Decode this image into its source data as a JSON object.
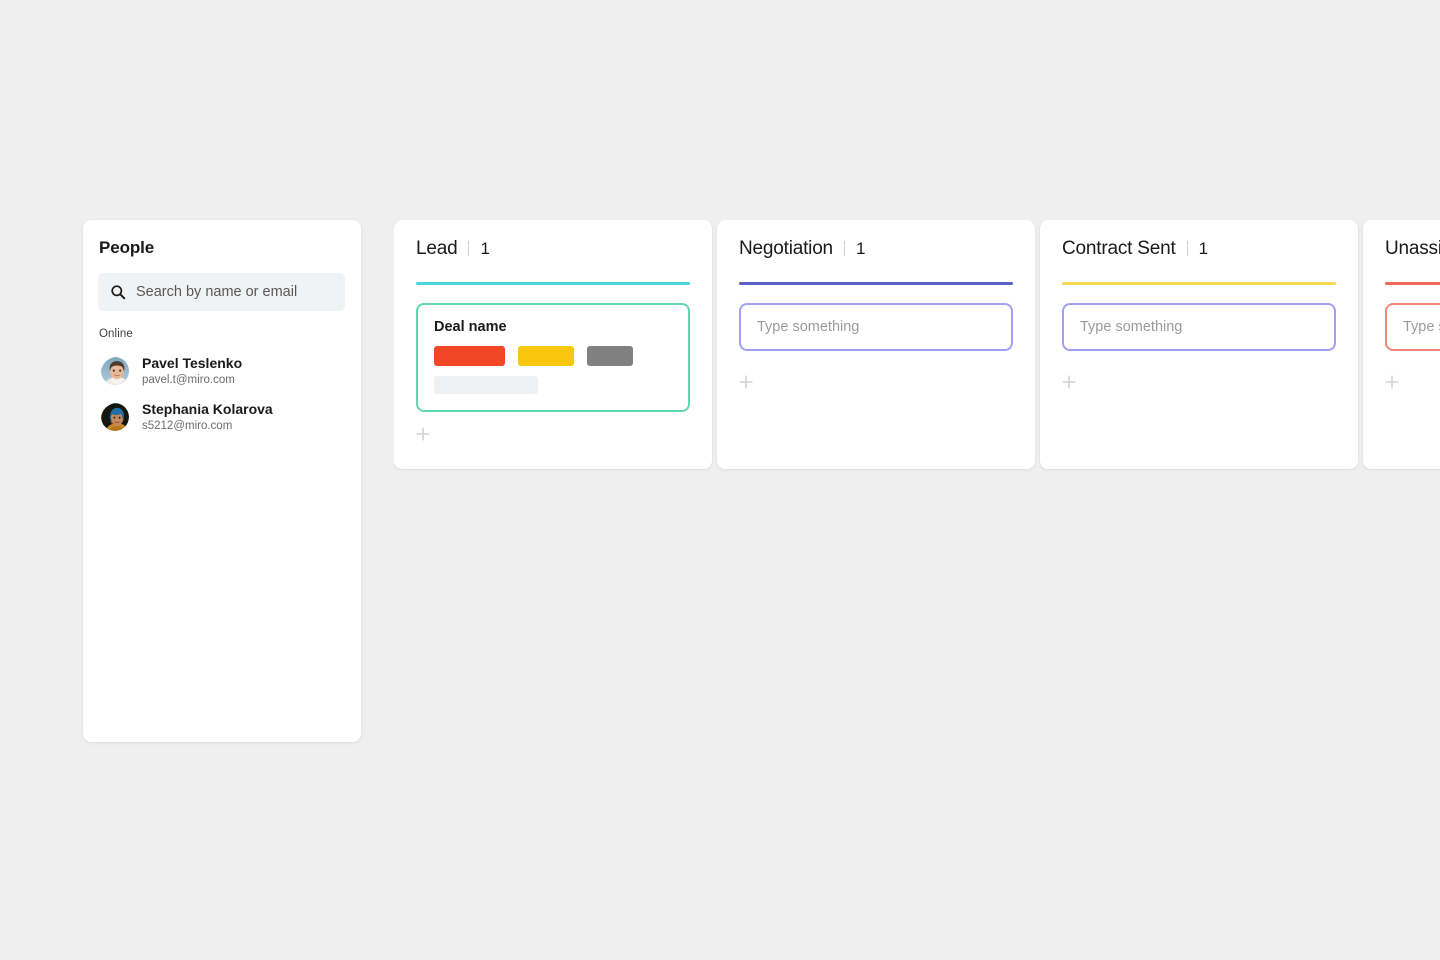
{
  "theme": {
    "page_background": "#efefef",
    "panel_background": "#ffffff",
    "text_primary": "#1a1a1a",
    "text_muted": "#6b6b6b"
  },
  "people_panel": {
    "title": "People",
    "search": {
      "icon": "search-icon",
      "value": "",
      "placeholder": "Search by name or email"
    },
    "section_label": "Online",
    "members": [
      {
        "name": "Pavel Teslenko",
        "email": "pavel.t@miro.com",
        "ring_color": "#4db8ff",
        "avatar": "photo-portrait-man"
      },
      {
        "name": "Stephania Kolarova",
        "email": "s5212@miro.com",
        "ring_color": "#4fd15e",
        "avatar": "photo-portrait-woman"
      }
    ]
  },
  "board": {
    "add_icon": "plus-icon",
    "columns": [
      {
        "title": "Lead",
        "count": "1",
        "separator": "|",
        "rule_color": "#4cd2e0",
        "card": {
          "kind": "deal",
          "border_color": "#5fd8ad",
          "name": "Deal name",
          "tags": [
            {
              "color": "#f24726",
              "label": ""
            },
            {
              "color": "#fac710",
              "label": ""
            },
            {
              "color": "#808080",
              "label": ""
            }
          ],
          "placeholder_bar_color": "#eff0f1"
        }
      },
      {
        "title": "Negotiation",
        "count": "1",
        "separator": "|",
        "rule_color": "#5b62c4",
        "card": {
          "kind": "input",
          "border_color": "#a2a0f5",
          "value": "",
          "placeholder": "Type something"
        }
      },
      {
        "title": "Contract Sent",
        "count": "1",
        "separator": "|",
        "rule_color": "#f6d94f",
        "card": {
          "kind": "input",
          "border_color": "#f9d televise",
          "value": "",
          "placeholder": "Type something"
        }
      },
      {
        "title": "Unassigned",
        "count": "",
        "separator": "",
        "rule_color": "#ef6a58",
        "card": {
          "kind": "input",
          "border_color": "#f3867c",
          "value": "",
          "placeholder": "Type something"
        }
      }
    ]
  }
}
